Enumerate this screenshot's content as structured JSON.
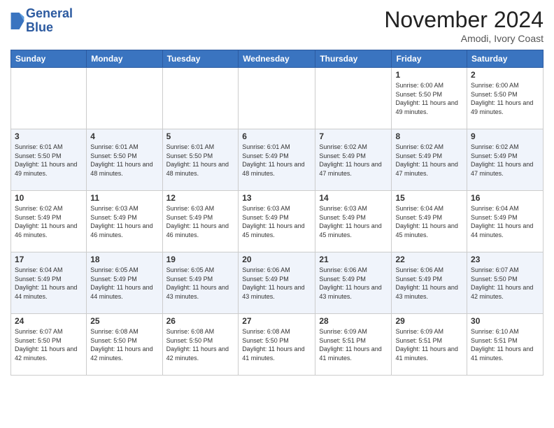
{
  "header": {
    "logo_line1": "General",
    "logo_line2": "Blue",
    "month_title": "November 2024",
    "location": "Amodi, Ivory Coast"
  },
  "weekdays": [
    "Sunday",
    "Monday",
    "Tuesday",
    "Wednesday",
    "Thursday",
    "Friday",
    "Saturday"
  ],
  "weeks": [
    [
      {
        "day": "",
        "info": ""
      },
      {
        "day": "",
        "info": ""
      },
      {
        "day": "",
        "info": ""
      },
      {
        "day": "",
        "info": ""
      },
      {
        "day": "",
        "info": ""
      },
      {
        "day": "1",
        "info": "Sunrise: 6:00 AM\nSunset: 5:50 PM\nDaylight: 11 hours and 49 minutes."
      },
      {
        "day": "2",
        "info": "Sunrise: 6:00 AM\nSunset: 5:50 PM\nDaylight: 11 hours and 49 minutes."
      }
    ],
    [
      {
        "day": "3",
        "info": "Sunrise: 6:01 AM\nSunset: 5:50 PM\nDaylight: 11 hours and 49 minutes."
      },
      {
        "day": "4",
        "info": "Sunrise: 6:01 AM\nSunset: 5:50 PM\nDaylight: 11 hours and 48 minutes."
      },
      {
        "day": "5",
        "info": "Sunrise: 6:01 AM\nSunset: 5:50 PM\nDaylight: 11 hours and 48 minutes."
      },
      {
        "day": "6",
        "info": "Sunrise: 6:01 AM\nSunset: 5:49 PM\nDaylight: 11 hours and 48 minutes."
      },
      {
        "day": "7",
        "info": "Sunrise: 6:02 AM\nSunset: 5:49 PM\nDaylight: 11 hours and 47 minutes."
      },
      {
        "day": "8",
        "info": "Sunrise: 6:02 AM\nSunset: 5:49 PM\nDaylight: 11 hours and 47 minutes."
      },
      {
        "day": "9",
        "info": "Sunrise: 6:02 AM\nSunset: 5:49 PM\nDaylight: 11 hours and 47 minutes."
      }
    ],
    [
      {
        "day": "10",
        "info": "Sunrise: 6:02 AM\nSunset: 5:49 PM\nDaylight: 11 hours and 46 minutes."
      },
      {
        "day": "11",
        "info": "Sunrise: 6:03 AM\nSunset: 5:49 PM\nDaylight: 11 hours and 46 minutes."
      },
      {
        "day": "12",
        "info": "Sunrise: 6:03 AM\nSunset: 5:49 PM\nDaylight: 11 hours and 46 minutes."
      },
      {
        "day": "13",
        "info": "Sunrise: 6:03 AM\nSunset: 5:49 PM\nDaylight: 11 hours and 45 minutes."
      },
      {
        "day": "14",
        "info": "Sunrise: 6:03 AM\nSunset: 5:49 PM\nDaylight: 11 hours and 45 minutes."
      },
      {
        "day": "15",
        "info": "Sunrise: 6:04 AM\nSunset: 5:49 PM\nDaylight: 11 hours and 45 minutes."
      },
      {
        "day": "16",
        "info": "Sunrise: 6:04 AM\nSunset: 5:49 PM\nDaylight: 11 hours and 44 minutes."
      }
    ],
    [
      {
        "day": "17",
        "info": "Sunrise: 6:04 AM\nSunset: 5:49 PM\nDaylight: 11 hours and 44 minutes."
      },
      {
        "day": "18",
        "info": "Sunrise: 6:05 AM\nSunset: 5:49 PM\nDaylight: 11 hours and 44 minutes."
      },
      {
        "day": "19",
        "info": "Sunrise: 6:05 AM\nSunset: 5:49 PM\nDaylight: 11 hours and 43 minutes."
      },
      {
        "day": "20",
        "info": "Sunrise: 6:06 AM\nSunset: 5:49 PM\nDaylight: 11 hours and 43 minutes."
      },
      {
        "day": "21",
        "info": "Sunrise: 6:06 AM\nSunset: 5:49 PM\nDaylight: 11 hours and 43 minutes."
      },
      {
        "day": "22",
        "info": "Sunrise: 6:06 AM\nSunset: 5:49 PM\nDaylight: 11 hours and 43 minutes."
      },
      {
        "day": "23",
        "info": "Sunrise: 6:07 AM\nSunset: 5:50 PM\nDaylight: 11 hours and 42 minutes."
      }
    ],
    [
      {
        "day": "24",
        "info": "Sunrise: 6:07 AM\nSunset: 5:50 PM\nDaylight: 11 hours and 42 minutes."
      },
      {
        "day": "25",
        "info": "Sunrise: 6:08 AM\nSunset: 5:50 PM\nDaylight: 11 hours and 42 minutes."
      },
      {
        "day": "26",
        "info": "Sunrise: 6:08 AM\nSunset: 5:50 PM\nDaylight: 11 hours and 42 minutes."
      },
      {
        "day": "27",
        "info": "Sunrise: 6:08 AM\nSunset: 5:50 PM\nDaylight: 11 hours and 41 minutes."
      },
      {
        "day": "28",
        "info": "Sunrise: 6:09 AM\nSunset: 5:51 PM\nDaylight: 11 hours and 41 minutes."
      },
      {
        "day": "29",
        "info": "Sunrise: 6:09 AM\nSunset: 5:51 PM\nDaylight: 11 hours and 41 minutes."
      },
      {
        "day": "30",
        "info": "Sunrise: 6:10 AM\nSunset: 5:51 PM\nDaylight: 11 hours and 41 minutes."
      }
    ]
  ]
}
